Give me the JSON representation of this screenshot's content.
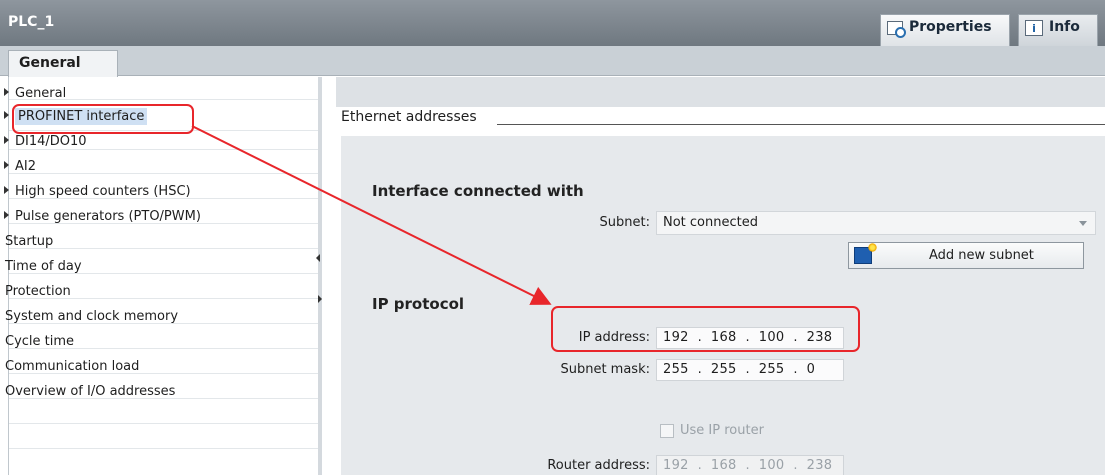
{
  "window": {
    "title": "PLC_1"
  },
  "tabs": {
    "properties": "Properties",
    "info": "Info"
  },
  "subtab": {
    "general": "General"
  },
  "nav": {
    "items": [
      {
        "label": "General",
        "expandable": true
      },
      {
        "label": "PROFINET interface",
        "expandable": true,
        "selected": true
      },
      {
        "label": "DI14/DO10",
        "expandable": true
      },
      {
        "label": "AI2",
        "expandable": true
      },
      {
        "label": "High speed counters (HSC)",
        "expandable": true
      },
      {
        "label": "Pulse generators (PTO/PWM)",
        "expandable": true
      },
      {
        "label": "Startup",
        "expandable": false
      },
      {
        "label": "Time of day",
        "expandable": false
      },
      {
        "label": "Protection",
        "expandable": false
      },
      {
        "label": "System and clock memory",
        "expandable": false
      },
      {
        "label": "Cycle time",
        "expandable": false
      },
      {
        "label": "Communication load",
        "expandable": false
      },
      {
        "label": "Overview of I/O addresses",
        "expandable": false
      }
    ]
  },
  "section": {
    "title": "Ethernet addresses"
  },
  "interface": {
    "heading": "Interface connected with",
    "subnet_label": "Subnet:",
    "subnet_value": "Not connected",
    "add_subnet_label": "Add new subnet"
  },
  "ip": {
    "heading": "IP protocol",
    "address_label": "IP address:",
    "address_value": "192  .  168  .  100  .  238",
    "mask_label": "Subnet mask:",
    "mask_value": "255  .  255  .  255  .  0",
    "use_router_label": "Use IP router",
    "use_router_checked": false,
    "router_label": "Router address:",
    "router_value": "192  .  168  .  100  .  238"
  },
  "colors": {
    "highlight": "#e8262b",
    "selection": "#cfe0f3"
  }
}
